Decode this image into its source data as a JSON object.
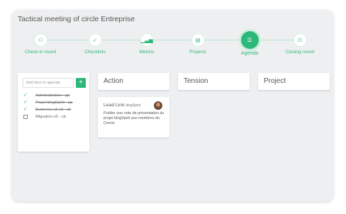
{
  "window": {
    "title": "Tactical meeting of circle Entreprise"
  },
  "steps": [
    {
      "label": "Check-in round",
      "icon": "users-icon",
      "glyph": "⚇",
      "active": false
    },
    {
      "label": "Checklists",
      "icon": "check-circle-icon",
      "glyph": "✓",
      "active": false
    },
    {
      "label": "Metrics",
      "icon": "bar-chart-icon",
      "glyph": "▁▃▅",
      "active": false
    },
    {
      "label": "Projects",
      "icon": "calendar-icon",
      "glyph": "▤",
      "active": false
    },
    {
      "label": "Agenda",
      "icon": "list-icon",
      "glyph": "☰",
      "active": true
    },
    {
      "label": "Closing round",
      "icon": "power-icon",
      "glyph": "⏻",
      "active": false
    }
  ],
  "sidebar": {
    "add_placeholder": "Add item to agenda",
    "add_label": "+",
    "items": [
      {
        "text": "Administration - pp",
        "done": true
      },
      {
        "text": "Projet blogSpirit - pp",
        "done": true
      },
      {
        "text": "Business v2 v3 - cb",
        "done": true
      },
      {
        "text": "Migration v3 - cb",
        "done": false
      }
    ]
  },
  "columns": {
    "action": "Action",
    "tension": "Tension",
    "project": "Project"
  },
  "card": {
    "role": "Lead Link",
    "circle": "blogSpirit",
    "body": "Publier une note de présentation du projet blogSpirit aux membres du Cercle"
  },
  "colors": {
    "accent": "#2db87a",
    "background": "#eeeff0"
  }
}
